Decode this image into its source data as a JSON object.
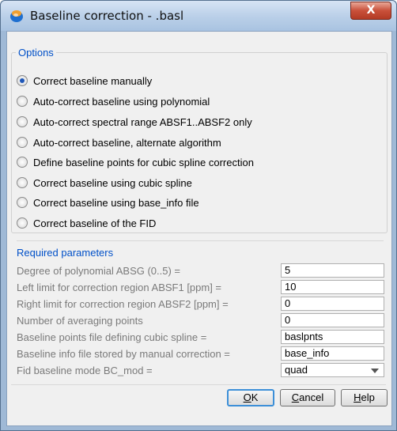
{
  "window": {
    "title": "Baseline correction - .basl",
    "close_label": "X"
  },
  "options": {
    "group_title": "Options",
    "items": [
      {
        "label": "Correct baseline manually",
        "checked": true
      },
      {
        "label": "Auto-correct baseline using polynomial",
        "checked": false
      },
      {
        "label": "Auto-correct spectral range ABSF1..ABSF2 only",
        "checked": false
      },
      {
        "label": "Auto-correct baseline, alternate algorithm",
        "checked": false
      },
      {
        "label": "Define baseline points for cubic spline correction",
        "checked": false
      },
      {
        "label": "Correct baseline using cubic spline",
        "checked": false
      },
      {
        "label": "Correct baseline using base_info file",
        "checked": false
      },
      {
        "label": "Correct baseline of the FID",
        "checked": false
      }
    ]
  },
  "params": {
    "group_title": "Required parameters",
    "rows": [
      {
        "label": "Degree of polynomial ABSG (0..5) =",
        "value": "5"
      },
      {
        "label": "Left limit for correction region ABSF1 [ppm] =",
        "value": "10"
      },
      {
        "label": "Right limit for correction region ABSF2 [ppm] =",
        "value": "0"
      },
      {
        "label": "Number of averaging points",
        "value": "0"
      },
      {
        "label": "Baseline points file defining cubic spline =",
        "value": "baslpnts"
      },
      {
        "label": "Baseline info file stored by manual correction =",
        "value": "base_info"
      },
      {
        "label": "Fid baseline mode BC_mod =",
        "value": "quad"
      }
    ]
  },
  "buttons": {
    "ok_mnemonic": "O",
    "ok_rest": "K",
    "cancel_mnemonic": "C",
    "cancel_rest": "ancel",
    "help_mnemonic": "H",
    "help_rest": "elp"
  }
}
